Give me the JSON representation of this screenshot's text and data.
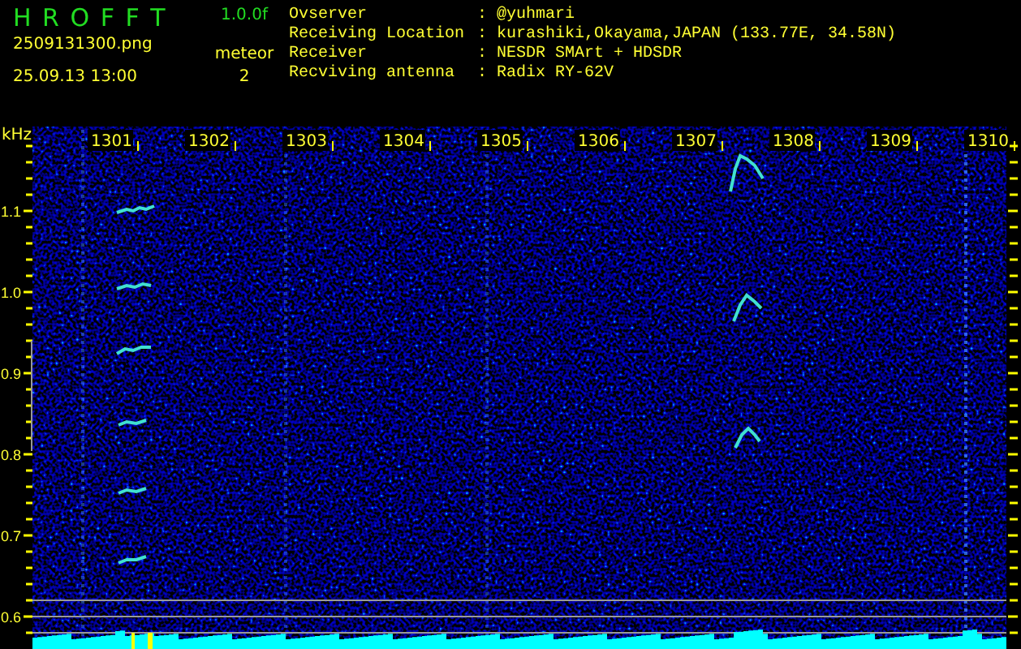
{
  "header": {
    "app_name": "H R O F F T",
    "version": "1.0.0f",
    "file_name": "2509131300.png",
    "timestamp": "25.09.13 13:00",
    "detection_label": "meteor",
    "detection_count": "2"
  },
  "station_info": [
    {
      "label": "Ovserver",
      "separator": ":",
      "value": "@yuhmari"
    },
    {
      "label": "Receiving Location",
      "separator": ":",
      "value": "kurashiki,Okayama,JAPAN (133.77E, 34.58N)"
    },
    {
      "label": "Receiver",
      "separator": ":",
      "value": "NESDR SMArt + HDSDR"
    },
    {
      "label": "Recviving antenna",
      "separator": ":",
      "value": "Radix RY-62V"
    }
  ],
  "spectrogram": {
    "y_unit": "kHz",
    "y_labels": [
      "1.1",
      "1.0",
      "0.9",
      "0.8",
      "0.7",
      "0.6"
    ],
    "time_labels": [
      "1301",
      "1302",
      "1303",
      "1304",
      "1305",
      "1306",
      "1307",
      "1308",
      "1309",
      "1310"
    ]
  }
}
